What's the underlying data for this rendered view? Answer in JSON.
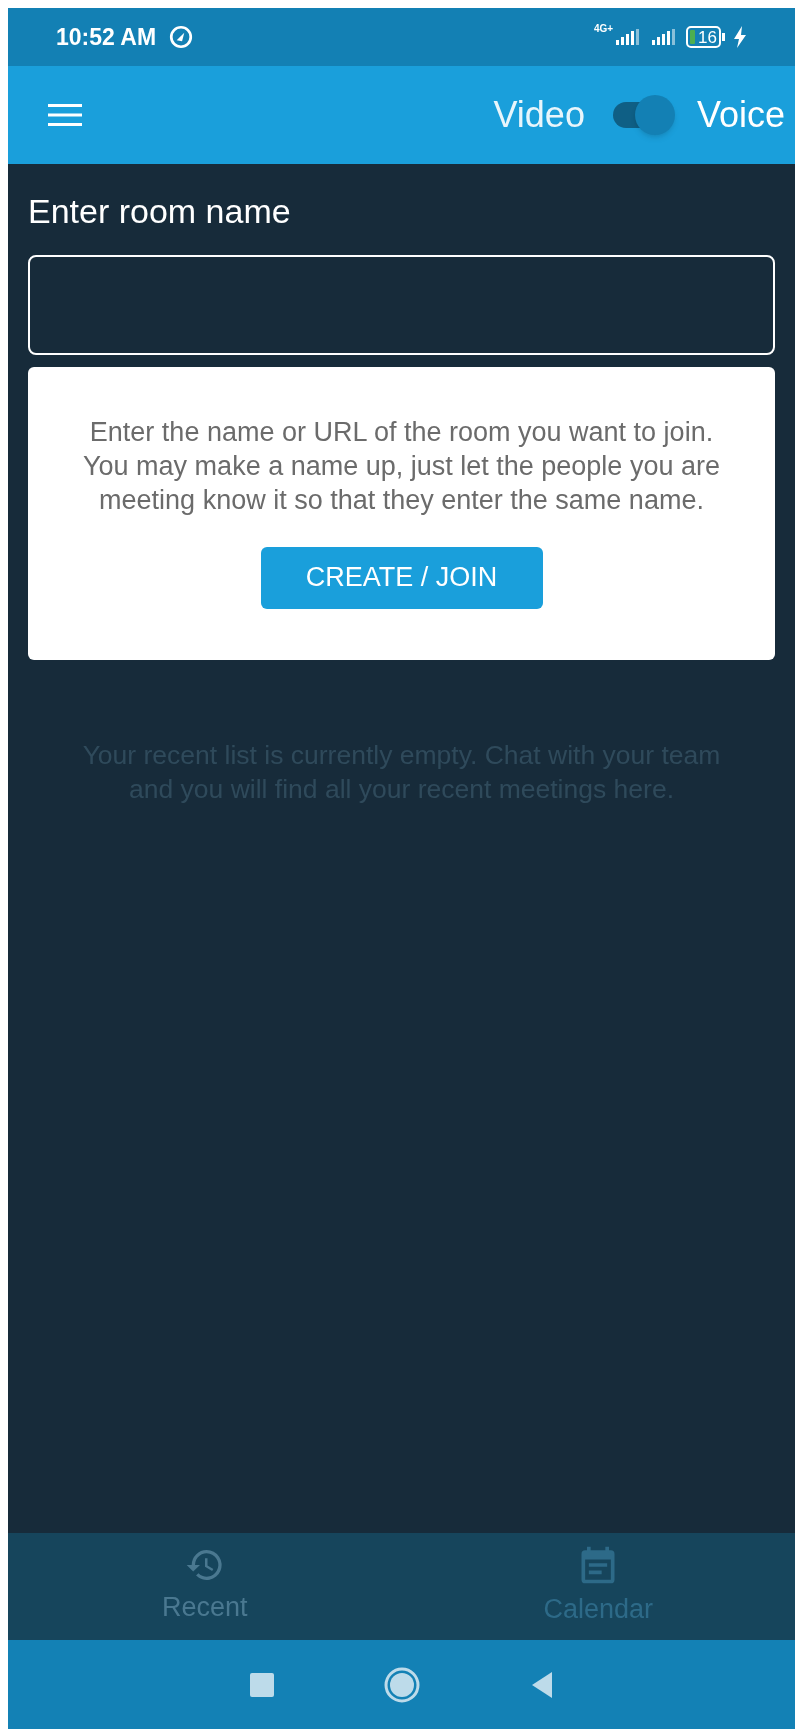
{
  "status_bar": {
    "time": "10:52 AM",
    "network": "4G+",
    "battery": "16"
  },
  "header": {
    "left_label": "Video",
    "right_label": "Voice",
    "toggle": {
      "on": true
    }
  },
  "room": {
    "title": "Enter room name",
    "hint": "Enter the name or URL of the room you want to join. You may make a name up, just let the people you are meeting know it so that they enter the same name.",
    "button": "CREATE / JOIN"
  },
  "recent_empty": "Your recent list is currently empty. Chat with your team and you will find all your recent meetings here.",
  "bottom_tabs": [
    {
      "kind": "recent",
      "label": "Recent",
      "selected": true
    },
    {
      "kind": "calendar",
      "label": "Calendar",
      "selected": false
    }
  ]
}
